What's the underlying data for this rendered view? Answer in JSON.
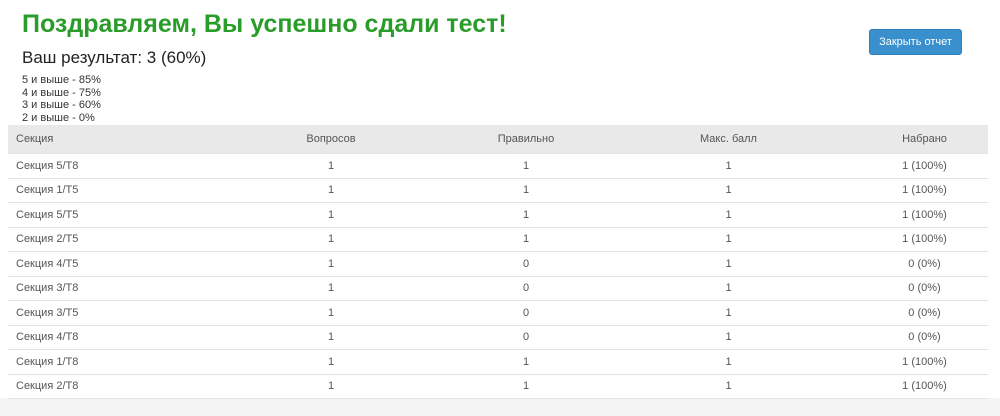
{
  "header": {
    "title": "Поздравляем, Вы успешно сдали тест!",
    "result": "Ваш результат: 3 (60%)",
    "grades": [
      "5 и выше - 85%",
      "4 и выше - 75%",
      "3 и выше - 60%",
      "2 и выше - 0%"
    ],
    "close_button": "Закрыть отчет"
  },
  "table": {
    "columns": [
      "Секция",
      "Вопросов",
      "Правильно",
      "Макс. балл",
      "Набрано"
    ],
    "rows": [
      [
        "Секция 5/Т8",
        "1",
        "1",
        "1",
        "1 (100%)"
      ],
      [
        "Секция 1/Т5",
        "1",
        "1",
        "1",
        "1 (100%)"
      ],
      [
        "Секция 5/Т5",
        "1",
        "1",
        "1",
        "1 (100%)"
      ],
      [
        "Секция 2/Т5",
        "1",
        "1",
        "1",
        "1 (100%)"
      ],
      [
        "Секция 4/Т5",
        "1",
        "0",
        "1",
        "0 (0%)"
      ],
      [
        "Секция 3/Т8",
        "1",
        "0",
        "1",
        "0 (0%)"
      ],
      [
        "Секция 3/Т5",
        "1",
        "0",
        "1",
        "0 (0%)"
      ],
      [
        "Секция 4/Т8",
        "1",
        "0",
        "1",
        "0 (0%)"
      ],
      [
        "Секция 1/Т8",
        "1",
        "1",
        "1",
        "1 (100%)"
      ],
      [
        "Секция 2/Т8",
        "1",
        "1",
        "1",
        "1 (100%)"
      ]
    ]
  },
  "colors": {
    "title_green": "#2a9c2a",
    "button_blue": "#3a8fcd",
    "header_row_bg": "#e9e9e9"
  }
}
